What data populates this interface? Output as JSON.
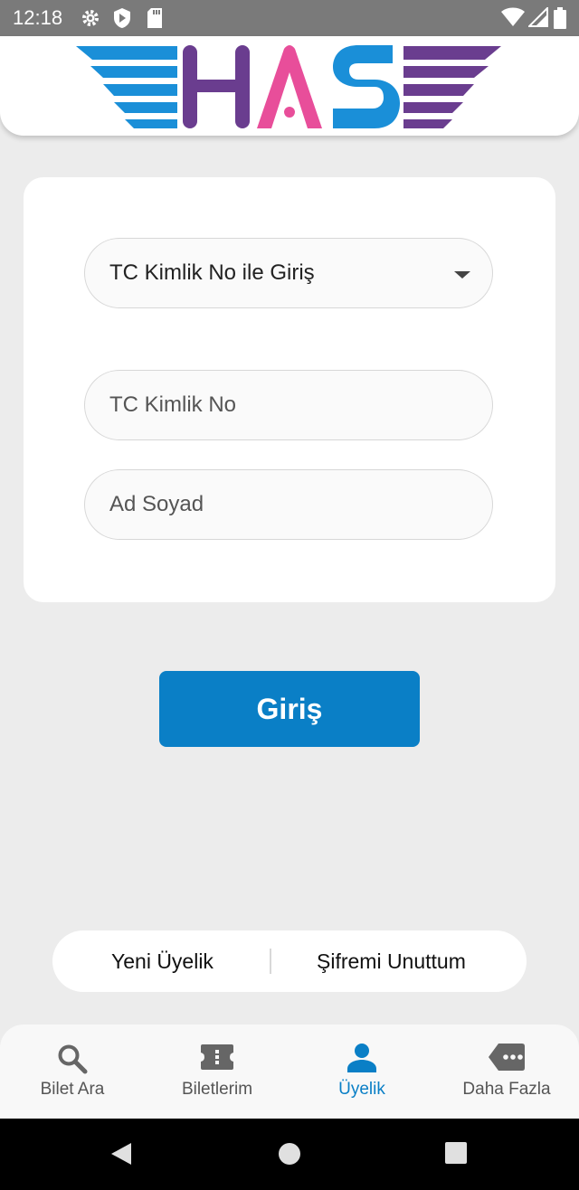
{
  "status_bar": {
    "time": "12:18",
    "icons": [
      "gear-icon",
      "shield-play-icon",
      "sd-card-icon",
      "wifi-icon",
      "signal-icon",
      "battery-icon"
    ]
  },
  "header": {
    "logo_text": "HAS",
    "colors": {
      "blue": "#1a8fd8",
      "purple": "#6a3d8f",
      "pink": "#e84e9a"
    }
  },
  "login_form": {
    "login_type": {
      "selected": "TC Kimlik No ile Giriş"
    },
    "tc_field": {
      "placeholder": "TC Kimlik No",
      "value": ""
    },
    "name_field": {
      "placeholder": "Ad Soyad",
      "value": ""
    }
  },
  "login_button": {
    "label": "Giriş"
  },
  "links": {
    "new_member": "Yeni Üyelik",
    "forgot_password": "Şifremi Unuttum"
  },
  "bottom_nav": {
    "items": [
      {
        "label": "Bilet Ara",
        "icon": "search-icon"
      },
      {
        "label": "Biletlerim",
        "icon": "ticket-icon"
      },
      {
        "label": "Üyelik",
        "icon": "person-icon",
        "active": true
      },
      {
        "label": "Daha Fazla",
        "icon": "more-tag-icon"
      }
    ]
  },
  "accent_color": "#0a7fc6"
}
